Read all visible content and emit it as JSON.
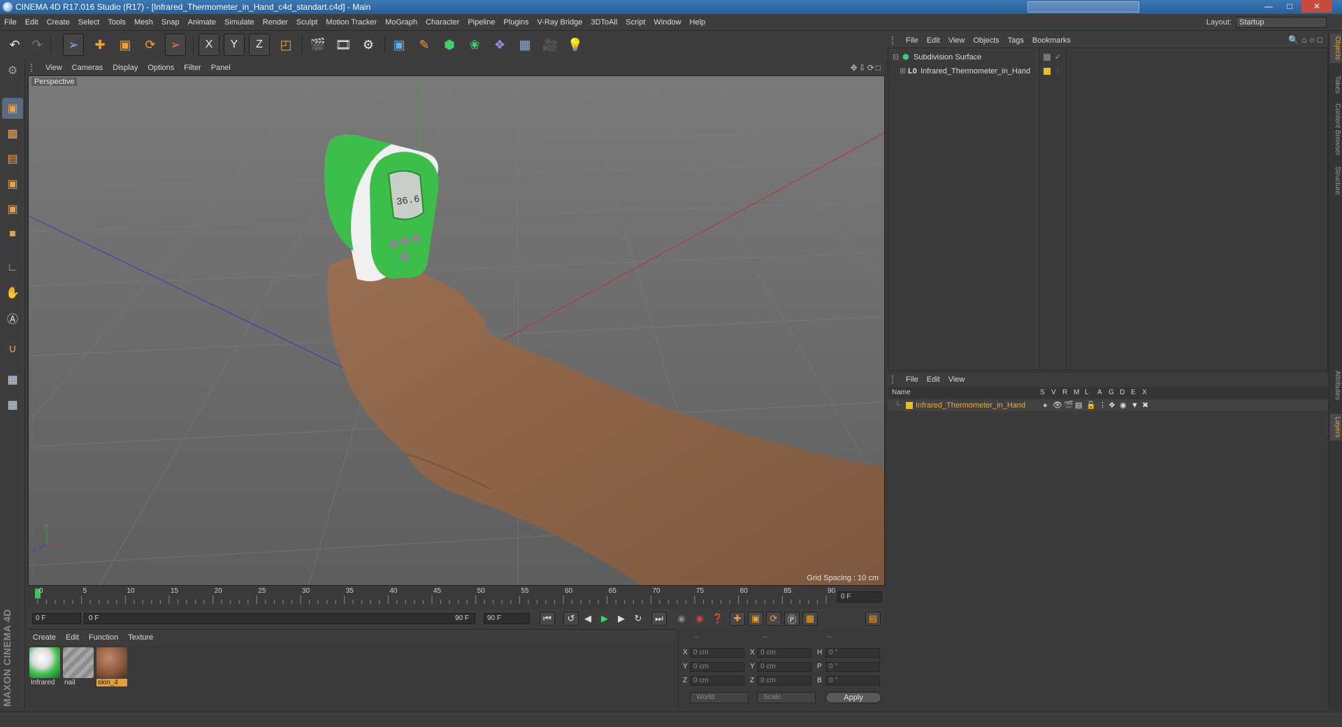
{
  "window": {
    "title": "CINEMA 4D R17.016 Studio (R17) - [Infrared_Thermometer_in_Hand_c4d_standart.c4d] - Main"
  },
  "menubar": {
    "items": [
      "File",
      "Edit",
      "Create",
      "Select",
      "Tools",
      "Mesh",
      "Snap",
      "Animate",
      "Simulate",
      "Render",
      "Sculpt",
      "Motion Tracker",
      "MoGraph",
      "Character",
      "Pipeline",
      "Plugins",
      "V-Ray Bridge",
      "3DToAll",
      "Script",
      "Window",
      "Help"
    ],
    "layout_label": "Layout:",
    "layout_value": "Startup"
  },
  "toolbar": {
    "axis_x": "X",
    "axis_y": "Y",
    "axis_z": "Z"
  },
  "viewport": {
    "menu": [
      "View",
      "Cameras",
      "Display",
      "Options",
      "Filter",
      "Panel"
    ],
    "label": "Perspective",
    "grid_spacing": "Grid Spacing : 10 cm",
    "display_readout": "36.6"
  },
  "timeline": {
    "ticks": [
      "0",
      "5",
      "10",
      "15",
      "20",
      "25",
      "30",
      "35",
      "40",
      "45",
      "50",
      "55",
      "60",
      "65",
      "70",
      "75",
      "80",
      "85",
      "90"
    ],
    "current_frame": "0 F"
  },
  "transport": {
    "start_field": "0 F",
    "range_start": "0 F",
    "range_end": "90 F",
    "end_field": "90 F"
  },
  "material_manager": {
    "menu": [
      "Create",
      "Edit",
      "Function",
      "Texture"
    ],
    "materials": [
      {
        "name": "Infrared",
        "selected": false
      },
      {
        "name": "nail",
        "selected": false
      },
      {
        "name": "skin_4",
        "selected": true
      }
    ]
  },
  "coordinates": {
    "headers": [
      "--",
      "--",
      "--"
    ],
    "rows": [
      {
        "a": "X",
        "av": "0 cm",
        "b": "X",
        "bv": "0 cm",
        "c": "H",
        "cv": "0 °"
      },
      {
        "a": "Y",
        "av": "0 cm",
        "b": "Y",
        "bv": "0 cm",
        "c": "P",
        "cv": "0 °"
      },
      {
        "a": "Z",
        "av": "0 cm",
        "b": "Z",
        "bv": "0 cm",
        "c": "B",
        "cv": "0 °"
      }
    ],
    "space": "World",
    "mode": "Scale",
    "apply": "Apply"
  },
  "object_manager": {
    "menu": [
      "File",
      "Edit",
      "View",
      "Objects",
      "Tags",
      "Bookmarks"
    ],
    "objects": [
      {
        "name": "Subdivision Surface"
      },
      {
        "name": "Infrared_Thermometer_in_Hand"
      }
    ]
  },
  "layer_manager": {
    "menu": [
      "File",
      "Edit",
      "View"
    ],
    "columns": [
      "Name",
      "S",
      "V",
      "R",
      "M",
      "L",
      "A",
      "G",
      "D",
      "E",
      "X"
    ],
    "layers": [
      {
        "name": "Infrared_Thermometer_in_Hand",
        "color": "#e8c020"
      }
    ]
  },
  "right_tabs": [
    "Objects",
    "Takes",
    "Content Browser",
    "Structure",
    "Attributes",
    "Layers"
  ],
  "branding": "MAXON CINEMA 4D",
  "colors": {
    "accent": "#e8a030",
    "viewport_bg": "#6b6b6b",
    "thermometer_green": "#3cbf4a",
    "layer_yellow": "#e8c020"
  }
}
